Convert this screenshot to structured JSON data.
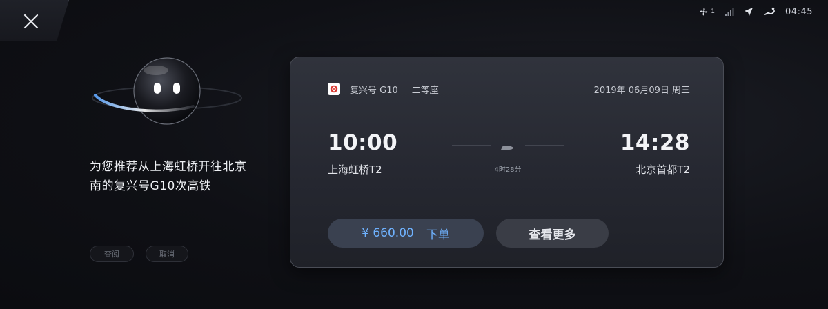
{
  "status_bar": {
    "fan_level": "1",
    "time": "04:45",
    "icons": [
      "fan-icon",
      "signal-icon",
      "location-arrow-icon",
      "seat-heat-icon"
    ]
  },
  "assistant": {
    "message": "为您推荐从上海虹桥开往北京南的复兴号G10次高铁",
    "hint_confirm": "查阅",
    "hint_cancel": "取消"
  },
  "ticket": {
    "train_name": "复兴号 G10",
    "seat_class": "二等座",
    "date": "2019年 06月09日 周三",
    "departure_time": "10:00",
    "departure_station": "上海虹桥T2",
    "arrival_time": "14:28",
    "arrival_station": "北京首都T2",
    "duration": "4时28分",
    "price": "¥ 660.00",
    "order_label": "下单",
    "more_label": "查看更多"
  },
  "colors": {
    "accent": "#6fb2ff",
    "background": "#0d0e12",
    "card": "#2a2d35"
  }
}
